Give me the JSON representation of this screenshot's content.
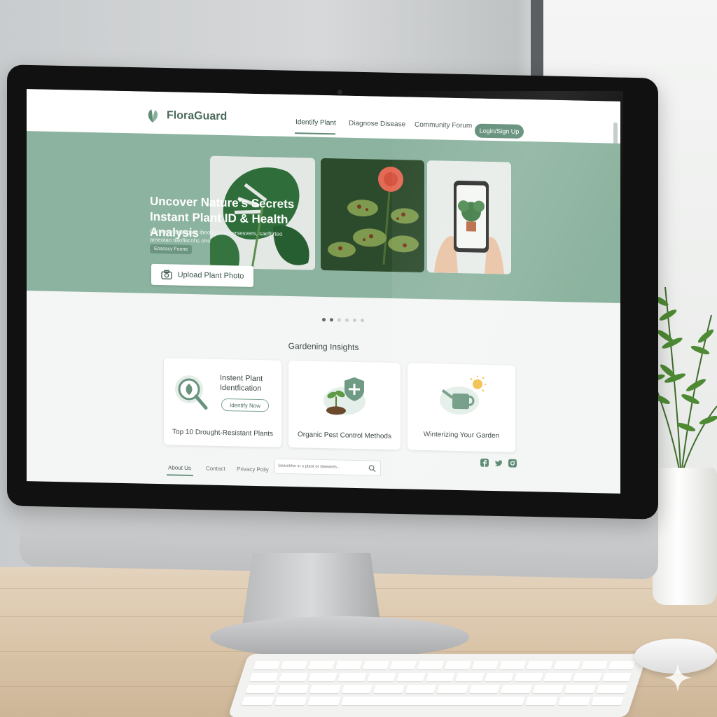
{
  "brand": {
    "name": "FloraGuard",
    "accent": "#5f8c76",
    "hero_bg": "#8cb39f"
  },
  "nav": {
    "links": [
      {
        "label": "Identify Plant",
        "active": true
      },
      {
        "label": "Diagnose Disease",
        "active": false
      },
      {
        "label": "Community Forum",
        "active": false
      }
    ],
    "login_label": "Login/Sign Up"
  },
  "hero": {
    "title_line1": "Uncover Nature's Secrets",
    "title_line2": "Instant Plant ID & Health Analysis",
    "subtitle": "Cement rtoirangaer ibeofigtiahrtaersesvers, saefrirteo ameotan tiaofiscohs ono",
    "chip": "Eosescy Foone",
    "upload_label": "Upload Plant Photo",
    "images": [
      {
        "icon": "monstera-leaf-image"
      },
      {
        "icon": "diseased-rose-image"
      },
      {
        "icon": "phone-plant-scan-image"
      }
    ]
  },
  "carousel": {
    "count": 6,
    "active_index": 0
  },
  "insights": {
    "heading": "Gardening Insights",
    "cards": [
      {
        "title": "Top 10 Drought-Resistant Plants",
        "small_title": "Instent Plant Identfication",
        "button_label": "Identify Now",
        "icon": "magnifier-leaf-icon"
      },
      {
        "title": "Organic Pest Control Methods",
        "icon": "sprout-shield-icon"
      },
      {
        "title": "Winterizing Your Garden",
        "icon": "watering-can-sun-icon"
      }
    ]
  },
  "footer": {
    "links": [
      {
        "label": "About Us",
        "active": true
      },
      {
        "label": "Contact",
        "active": false
      },
      {
        "label": "Privacy Poliy",
        "active": false
      }
    ],
    "search": {
      "placeholder": "Searchfor in s plant or diseases..."
    },
    "social": [
      "facebook-icon",
      "twitter-icon",
      "instagram-icon"
    ]
  }
}
